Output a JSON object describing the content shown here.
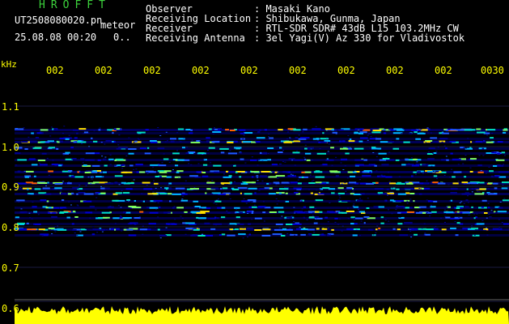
{
  "header": {
    "app_title": "HROFFT",
    "file_name": "UT2508080020.pn",
    "file_tag": "meteor",
    "date_time": "25.08.08 00:20",
    "date_extra": "0..",
    "observer_label": "Observer",
    "observer_value": ": Masaki Kano",
    "location_label": "Receiving Location",
    "location_value": ": Shibukawa, Gunma, Japan",
    "receiver_label": "Receiver",
    "receiver_value": ": RTL-SDR SDR# 43dB L15 103.2MHz CW",
    "antenna_label": "Receiving Antenna",
    "antenna_value": ": 3el Yagi(V) Az 330 for Vladivostok"
  },
  "axis": {
    "y_unit": "kHz",
    "y_ticks": [
      "1.1",
      "1.0",
      "0.9",
      "0.8",
      "0.7",
      "0.6"
    ],
    "time_ticks": [
      "002",
      "002",
      "002",
      "002",
      "002",
      "002",
      "002",
      "002",
      "002",
      "0030"
    ]
  },
  "colors": {
    "background": "#000000",
    "title": "#3cd23c",
    "axis_text": "#ffff00",
    "info_text": "#ffffff",
    "signal_bar": "#ffff00"
  }
}
